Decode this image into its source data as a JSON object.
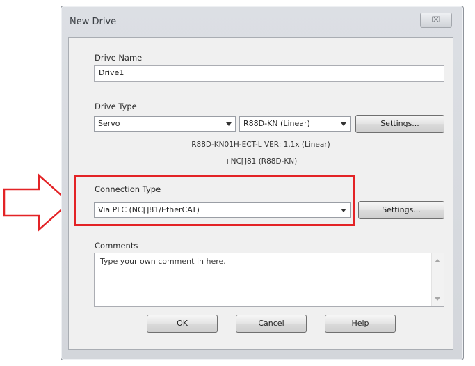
{
  "dialog": {
    "title": "New Drive",
    "close_label": "⌧"
  },
  "drive_name": {
    "label": "Drive Name",
    "value": "Drive1"
  },
  "drive_type": {
    "label": "Drive Type",
    "type_value": "Servo",
    "model_value": "R88D-KN (Linear)",
    "settings_label": "Settings...",
    "info_line1": "R88D-KN01H-ECT-L VER: 1.1x (Linear)",
    "info_line2": "+NC[]81 (R88D-KN)"
  },
  "connection_type": {
    "label": "Connection Type",
    "value": "Via PLC (NC[]81/EtherCAT)",
    "settings_label": "Settings..."
  },
  "comments": {
    "label": "Comments",
    "value": "Type your own comment in here."
  },
  "buttons": {
    "ok": "OK",
    "cancel": "Cancel",
    "help": "Help"
  },
  "annotation": {
    "highlight_color": "#e32326",
    "arrow_color": "#e32326"
  }
}
